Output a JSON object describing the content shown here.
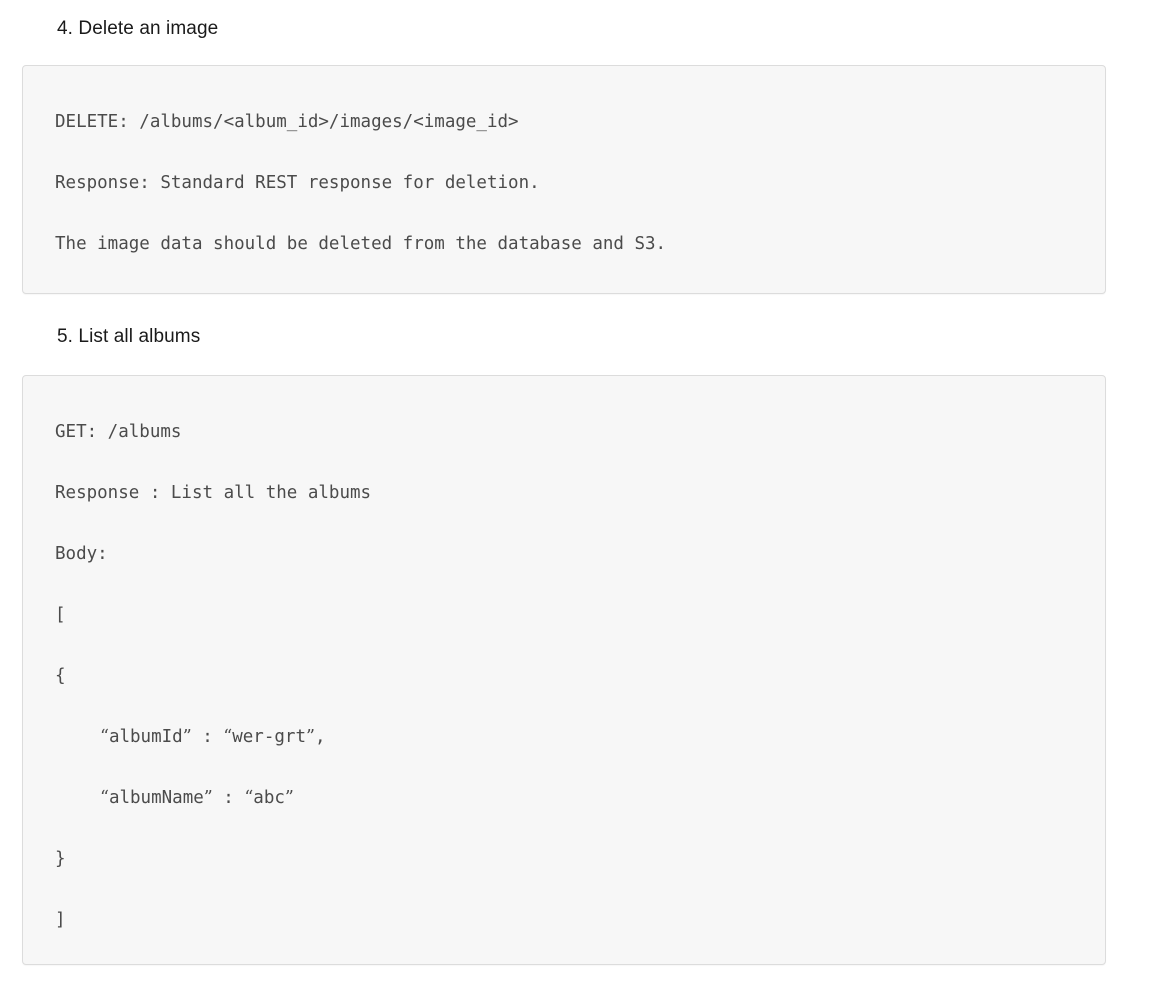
{
  "document": {
    "type": "api-documentation",
    "background_color": "#ffffff",
    "code_block_background": "#f7f7f7",
    "code_block_border_color": "#dcdcdc",
    "code_text_color": "#4b4b4b",
    "heading_text_color": "#1a1a1a"
  },
  "sections": [
    {
      "id": "delete-an-image",
      "heading": "4. Delete an image",
      "code_lines": [
        {
          "text": "DELETE: /albums/<album_id>/images/<image_id>",
          "indent": 0
        },
        {
          "text": "",
          "indent": 0
        },
        {
          "text": "Response: Standard REST response for deletion.",
          "indent": 0
        },
        {
          "text": "",
          "indent": 0
        },
        {
          "text": "The image data should be deleted from the database and S3.",
          "indent": 0
        }
      ]
    },
    {
      "id": "list-all-albums",
      "heading": "5. List all albums",
      "code_lines": [
        {
          "text": "GET: /albums",
          "indent": 0
        },
        {
          "text": "",
          "indent": 0
        },
        {
          "text": "Response : List all the albums",
          "indent": 0
        },
        {
          "text": "",
          "indent": 0
        },
        {
          "text": "Body:",
          "indent": 0
        },
        {
          "text": "",
          "indent": 0
        },
        {
          "text": "[",
          "indent": 0
        },
        {
          "text": "",
          "indent": 0
        },
        {
          "text": "{",
          "indent": 0
        },
        {
          "text": "",
          "indent": 0
        },
        {
          "text": "“albumId” : “wer-grt”,",
          "indent": 1
        },
        {
          "text": "",
          "indent": 0
        },
        {
          "text": "“albumName” : “abc”",
          "indent": 1
        },
        {
          "text": "",
          "indent": 0
        },
        {
          "text": "}",
          "indent": 0
        },
        {
          "text": "",
          "indent": 0
        },
        {
          "text": "]",
          "indent": 0
        }
      ]
    }
  ],
  "section_4": {
    "heading": "4. Delete an image",
    "line_1": "DELETE: /albums/<album_id>/images/<image_id>",
    "line_2": "Response: Standard REST response for deletion.",
    "line_3": "The image data should be deleted from the database and S3."
  },
  "section_5": {
    "heading": "5. List all albums",
    "line_1": "GET: /albums",
    "line_2": "Response : List all the albums",
    "line_3": "Body:",
    "line_4": "[",
    "line_5": "{",
    "line_6": "“albumId” : “wer-grt”,",
    "line_7": "“albumName” : “abc”",
    "line_8": "}",
    "line_9": "]"
  }
}
